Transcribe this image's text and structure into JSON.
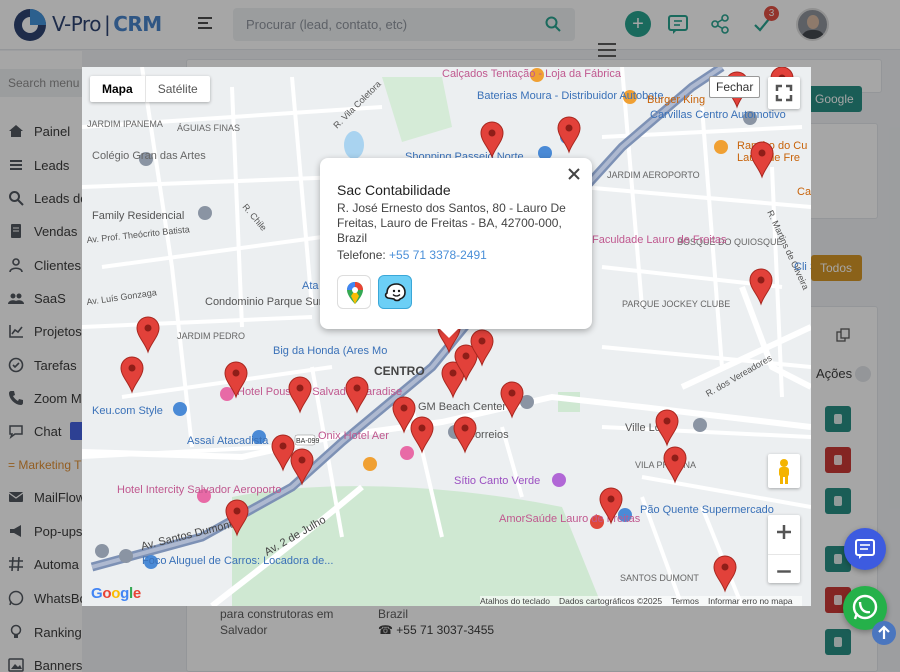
{
  "app": {
    "brand_main": "V-Pro",
    "brand_sep": "|",
    "brand_crm": "CRM"
  },
  "header": {
    "search_placeholder": "Procurar (lead, contato, etc)",
    "notification_count": "3"
  },
  "sidebar": {
    "search_placeholder": "Search menu",
    "items": [
      {
        "label": "Painel",
        "icon": "home-icon"
      },
      {
        "label": "Leads",
        "icon": "leads-icon"
      },
      {
        "label": "Leads do",
        "icon": "search-icon"
      },
      {
        "label": "Vendas",
        "icon": "document-icon"
      },
      {
        "label": "Clientes",
        "icon": "user-icon"
      },
      {
        "label": "SaaS",
        "icon": "users-icon"
      },
      {
        "label": "Projetos",
        "icon": "chart-icon"
      },
      {
        "label": "Tarefas",
        "icon": "check-circle-icon"
      },
      {
        "label": "Zoom M",
        "icon": "phone-icon"
      },
      {
        "label": "Chat",
        "icon": "chat-icon"
      }
    ],
    "section_marketing": "= Marketing T",
    "items2": [
      {
        "label": "MailFlow",
        "icon": "mail-icon"
      },
      {
        "label": "Pop-ups",
        "icon": "megaphone-icon"
      },
      {
        "label": "Automa",
        "icon": "hashtag-icon"
      },
      {
        "label": "WhatsBo",
        "icon": "whatsapp-icon"
      },
      {
        "label": "Ranking de Idéias",
        "icon": "lightbulb-icon"
      },
      {
        "label": "Banners",
        "icon": "image-icon"
      }
    ]
  },
  "page": {
    "google_button": "Google",
    "todos_button": "Todos",
    "acoes_label": "Ações",
    "row_text1": "para construtoras em",
    "row_text2": "Salvador",
    "row_country": "Brazil",
    "row_phone": "+55 71 3037-3455",
    "colors": {
      "teal": "#1d8a7e",
      "red": "#c8302c",
      "orange": "#d4921c"
    }
  },
  "map": {
    "type_map": "Mapa",
    "type_satellite": "Satélite",
    "close_label": "Fechar",
    "popup": {
      "title": "Sac Contabilidade",
      "address": "R. José Ernesto dos Santos, 80 - Lauro De Freitas, Lauro de Freitas - BA, 42700-000, Brazil",
      "phone_label": "Telefone: ",
      "phone": "+55 71 3378-2491"
    },
    "attribution": [
      "Atalhos do teclado",
      "Dados cartográficos ©2025",
      "Termos",
      "Informar erro no mapa"
    ],
    "google_logo": "Google",
    "labels": [
      "Calçados Tentação - Loja da Fábrica",
      "Baterias Moura - Distribuidor Autobate",
      "Burger King",
      "Carvillas Centro Automotivo",
      "Rancho do Cu",
      "Lauro de Fre",
      "Shopping Passeio Norte",
      "JARDIM AEROPORTO",
      "ÁGUIAS FINAS",
      "JARDIM IPANEMA",
      "Colégio Gran das Artes",
      "Family Residencial",
      "Av. Prof. Theócrito Batista",
      "R. Chile",
      "Av. Luís Gonzaga",
      "Condominio Parque Sun City",
      "JARDIM PEDRO",
      "PARQUE JOCKEY CLUBE",
      "BOSQUE DO QUIOSQUE",
      "Big da Honda (Ares Mo",
      "CENTRO",
      "Hotel Pousada Salvador Paradise",
      "Keu.com Style",
      "Assaí Atacadista",
      "GM Beach Center",
      "Correios",
      "Ville Lo",
      "VILA PRAIANA",
      "Onix Hotel Aer",
      "Sítio Canto Verde",
      "Hotel Intercity Salvador Aeroporto",
      "AmorSaúde Lauro de Freitas",
      "Pão Quente Supermercado",
      "Av. 2 de Julho",
      "Av. Santos Dumont",
      "Foco Aluguel de Carros: Locadora de...",
      "SANTOS DUMONT",
      "R. dos Vereadores",
      "R. Martins de Oliveira",
      "R. Vila Coletora",
      "Faculdade Lauro de Freitas",
      "Cli She",
      "Ca",
      "BA-099",
      "Ata"
    ]
  },
  "icons": {
    "search": "search-icon",
    "plus": "plus-icon",
    "chat": "chat-icon",
    "share": "share-icon",
    "check": "check-icon",
    "fullscreen": "fullscreen-icon",
    "zoom_in": "plus-icon",
    "zoom_out": "minus-icon",
    "pegman": "pegman-icon",
    "marker": "map-marker-icon",
    "gmaps": "google-maps-icon",
    "waze": "waze-icon",
    "whatsapp": "whatsapp-icon"
  }
}
